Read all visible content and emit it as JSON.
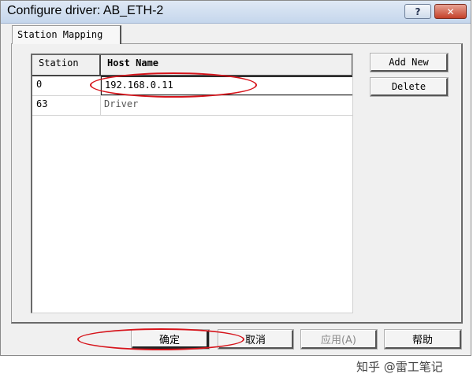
{
  "window": {
    "title": "Configure driver: AB_ETH-2",
    "help_label": "?",
    "close_label": "✕"
  },
  "tabs": [
    {
      "label": "Station Mapping"
    }
  ],
  "table": {
    "columns": [
      "Station",
      "Host Name"
    ],
    "rows": [
      {
        "station": "0",
        "host": "192.168.0.11"
      },
      {
        "station": "63",
        "host": "Driver"
      }
    ]
  },
  "side_buttons": {
    "add_new": "Add New",
    "delete": "Delete"
  },
  "bottom_buttons": {
    "ok": "确定",
    "cancel": "取消",
    "apply": "应用(A)",
    "help": "帮助"
  },
  "watermark": "知乎 @雷工笔记",
  "colors": {
    "annotation": "#d6141b",
    "disabled_text": "#8a8a8a"
  }
}
